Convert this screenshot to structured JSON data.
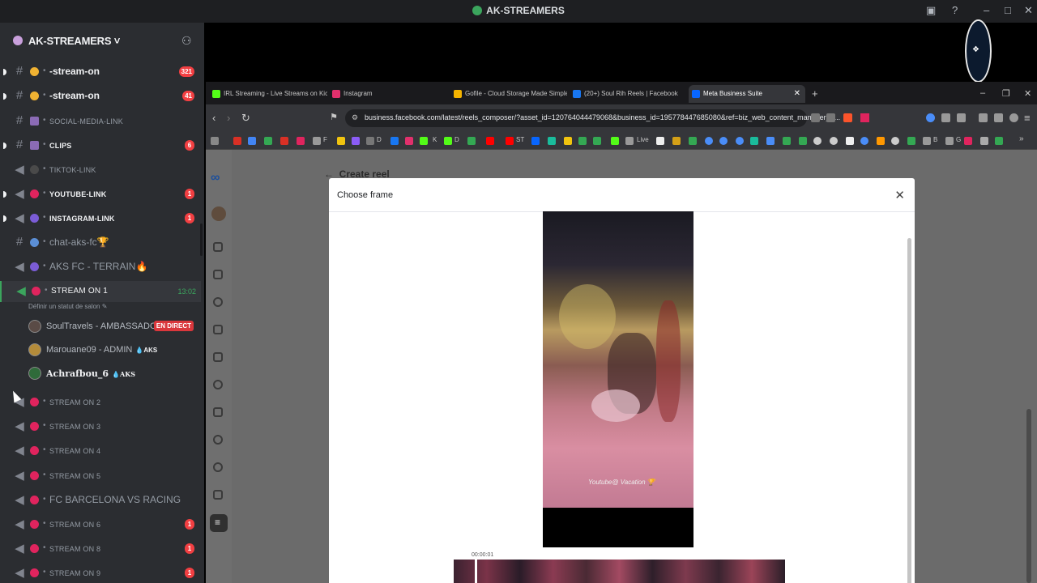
{
  "window": {
    "title": "AK-STREAMERS"
  },
  "server": {
    "name": "AK-STREAMERS ˅"
  },
  "channels": [
    {
      "name": "-stream-on",
      "badge": "321"
    },
    {
      "name": "-stream-on",
      "badge": "41"
    },
    {
      "name": "SOCIAL-MEDIA-LINK",
      "badge": ""
    },
    {
      "name": "CLIPS",
      "badge": "6"
    },
    {
      "name": "TIKTOK-LINK",
      "badge": ""
    },
    {
      "name": "YOUTUBE-LINK",
      "badge": "1"
    },
    {
      "name": "INSTAGRAM-LINK",
      "badge": "1"
    },
    {
      "name": "chat-aks-fc🏆",
      "badge": ""
    },
    {
      "name": "AKS FC - TERRAIN🔥",
      "badge": ""
    },
    {
      "name": "STREAM ON 1",
      "time": "13:02",
      "status": "Définir un statut de salon ✎"
    },
    {
      "name": "STREAM ON 2",
      "badge": ""
    },
    {
      "name": "STREAM ON 3",
      "badge": ""
    },
    {
      "name": "STREAM ON 4",
      "badge": ""
    },
    {
      "name": "STREAM ON 5",
      "badge": ""
    },
    {
      "name": "FC BARCELONA VS RACING",
      "badge": ""
    },
    {
      "name": "STREAM ON 6",
      "badge": "1"
    },
    {
      "name": "STREAM ON 8",
      "badge": "1"
    },
    {
      "name": "STREAM ON 9",
      "badge": "1"
    }
  ],
  "voice_users": [
    {
      "name": "SoulTravels - AMBASSADOR",
      "live": "EN DIRECT",
      "tag": ""
    },
    {
      "name": "Marouane09 - ADMIN",
      "tag": "💧AKS"
    },
    {
      "name": "Achrafbou_6",
      "tag": "💧AKS"
    }
  ],
  "browser": {
    "tabs": [
      {
        "label": "IRL Streaming - Live Streams on Kick",
        "color": "#53fc18"
      },
      {
        "label": "Instagram",
        "color": "#e1306c"
      },
      {
        "label": "Gofile - Cloud Storage Made Simple",
        "color": "#f5b400"
      },
      {
        "label": "(20+) Soul Rih Reels | Facebook",
        "color": "#1877f2"
      },
      {
        "label": "Meta Business Suite",
        "color": "#0866ff"
      }
    ],
    "url": "business.facebook.com/latest/reels_composer/?asset_id=120764044479068&business_id=195778447685080&ref=biz_web_content_manager_p...",
    "bookmarks": [
      {
        "label": "F"
      },
      {
        "label": "D"
      },
      {
        "label": "K"
      },
      {
        "label": "D"
      },
      {
        "label": "ST"
      },
      {
        "label": "Live"
      },
      {
        "label": "B"
      },
      {
        "label": "G"
      }
    ]
  },
  "page": {
    "heading": "Create reel",
    "modal_title": "Choose frame",
    "timestamp": "00:00:01",
    "watermark": "Youtube@ Vacation 🏆"
  }
}
